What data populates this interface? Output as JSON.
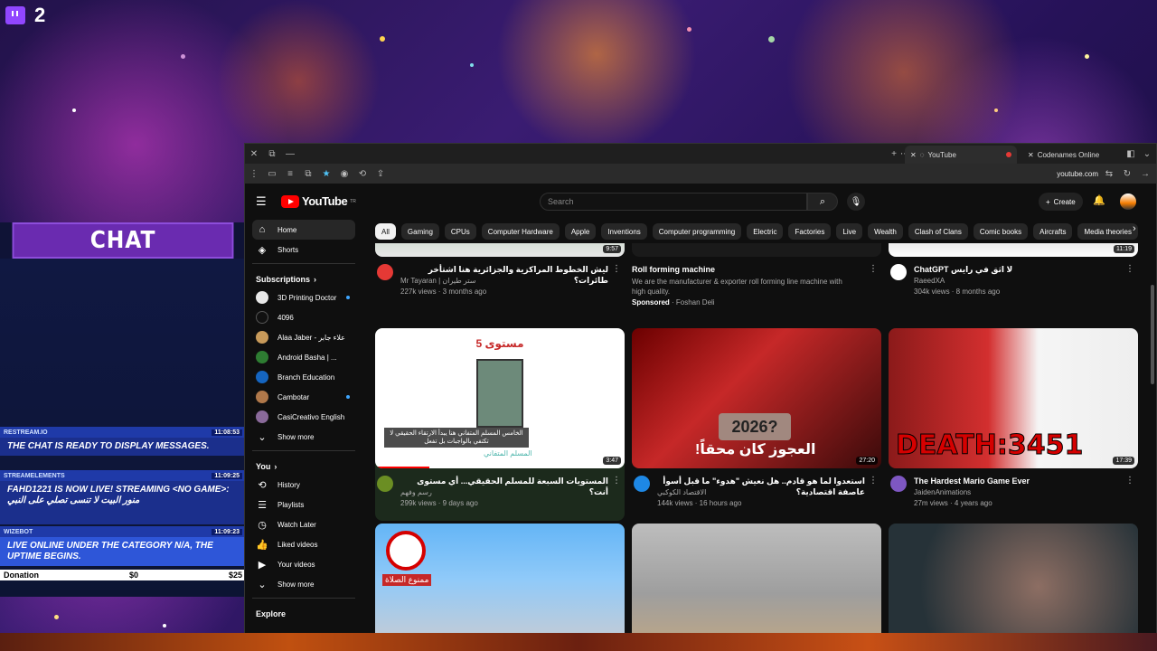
{
  "twitch": {
    "viewer_count": "2",
    "icon": "twitch-icon"
  },
  "chat": {
    "title": "CHAT",
    "messages": [
      {
        "user": "RESTREAM.IO",
        "time": "11:08:53",
        "text": "THE CHAT IS READY TO DISPLAY MESSAGES."
      },
      {
        "user": "STREAMELEMENTS",
        "time": "11:09:25",
        "text": "FAHD1221 IS NOW LIVE! STREAMING <NO GAME>: منور البيت لا تنسى تصلي على النبي"
      },
      {
        "user": "WIZEBOT",
        "time": "11:09:23",
        "text": "LIVE ONLINE UNDER THE CATEGORY N/A, THE UPTIME BEGINS."
      }
    ],
    "donation": {
      "label": "Donation",
      "amount": "$0",
      "goal": "$25"
    }
  },
  "browser": {
    "tabs": [
      {
        "label": "YouTube",
        "active": true
      },
      {
        "label": "Codenames Online",
        "active": false
      }
    ],
    "url": "youtube.com"
  },
  "youtube": {
    "logo": "YouTube",
    "logo_sup": "TR",
    "search_placeholder": "Search",
    "create_label": "Create",
    "sidebar": {
      "main": [
        {
          "label": "Home",
          "icon": "home-icon",
          "active": true
        },
        {
          "label": "Shorts",
          "icon": "shorts-icon"
        }
      ],
      "subscriptions_title": "Subscriptions",
      "subscriptions": [
        {
          "label": "3D Printing Doctor",
          "color": "#e8e8e8",
          "dot": true
        },
        {
          "label": "4096",
          "color": "#111",
          "dot": false
        },
        {
          "label": "Alaa Jaber - علاء جابر",
          "color": "#c89a5a",
          "dot": false
        },
        {
          "label": "Android Basha | ...",
          "color": "#2e7d32",
          "dot": false
        },
        {
          "label": "Branch Education",
          "color": "#1565c0",
          "dot": false
        },
        {
          "label": "Cambotar",
          "color": "#b0784a",
          "dot": true
        },
        {
          "label": "CasiCreativo English",
          "color": "#8a6a9a",
          "dot": false
        }
      ],
      "show_more": "Show more",
      "you_title": "You",
      "you": [
        {
          "label": "History",
          "icon": "history-icon"
        },
        {
          "label": "Playlists",
          "icon": "playlists-icon"
        },
        {
          "label": "Watch Later",
          "icon": "clock-icon"
        },
        {
          "label": "Liked videos",
          "icon": "thumbs-up-icon"
        },
        {
          "label": "Your videos",
          "icon": "video-icon"
        }
      ],
      "show_more_2": "Show more",
      "explore_title": "Explore"
    },
    "chips": [
      "All",
      "Gaming",
      "CPUs",
      "Computer Hardware",
      "Apple",
      "Inventions",
      "Computer programming",
      "Electric",
      "Factories",
      "Live",
      "Wealth",
      "Clash of Clans",
      "Comic books",
      "Aircrafts",
      "Media theories"
    ],
    "row1": [
      {
        "title": "ليش الخطوط المراكزية والجزائرية هنا اشتأخر طائرات؟",
        "channel": "Mr Tayaran | ستر طيران",
        "stats": "227k views · 3 months ago",
        "duration": "9:57",
        "avatar": "#e53935"
      },
      {
        "title": "Roll forming machine",
        "desc": "We are the manufacturer & exporter roll forming line machine with high quality.",
        "sponsor": "Sponsored",
        "advertiser": "Foshan Deli",
        "avatar": "#eee"
      },
      {
        "title": "ChatGPT لا اثق في رايس",
        "channel": "RaeedXA",
        "stats": "304k views · 8 months ago",
        "duration": "11:19",
        "avatar": "#fff"
      }
    ],
    "row2": [
      {
        "title": "المستويات السبعة للمسلم الحقيقي... أي مستوى أنت؟",
        "channel": "رسم وفهم",
        "stats": "299k views · 9 days ago",
        "duration": "3:47",
        "avatar": "#6b8e23",
        "thumb_heading": "مستوى 5",
        "thumb_caption": "الخامس المسلم المتفاني هنا يبدأ الارتقاء الحقيقي لا تكتفي بالواجبات بل تفعل",
        "thumb_sub": "المسلم المتفاني"
      },
      {
        "title": "استعدوا لما هو قادم.. هل نعيش \"هدوء\" ما قبل أسوأ عاصفة اقتصادية؟",
        "channel": "الاقتصاد الكوكبي",
        "stats": "144k views · 16 hours ago",
        "duration": "27:20",
        "avatar": "#1e88e5",
        "thumb_heading": "2026?",
        "thumb_caption": "العجوز كان محقاً!"
      },
      {
        "title": "The Hardest Mario Game Ever",
        "channel": "JaidenAnimations",
        "stats": "27m views · 4 years ago",
        "duration": "17:39",
        "avatar": "#7e57c2",
        "thumb_caption": "DEATH:3451"
      }
    ],
    "row3": [
      {
        "thumb_caption": "ممنوع الصلاة"
      },
      {
        "thumb_caption": ""
      },
      {
        "thumb_caption": ""
      }
    ]
  }
}
